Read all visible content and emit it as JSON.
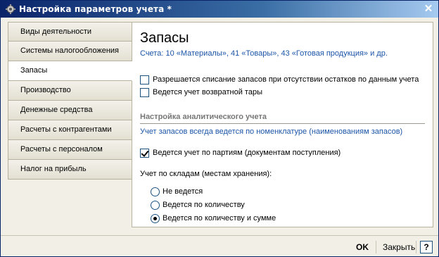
{
  "window": {
    "title": "Настройка параметров учета *",
    "close_glyph": "✕"
  },
  "sidebar": {
    "items": [
      {
        "label": "Виды деятельности",
        "active": false
      },
      {
        "label": "Системы налогообложения",
        "active": false
      },
      {
        "label": "Запасы",
        "active": true
      },
      {
        "label": "Производство",
        "active": false
      },
      {
        "label": "Денежные средства",
        "active": false
      },
      {
        "label": "Расчеты с контрагентами",
        "active": false
      },
      {
        "label": "Расчеты с персоналом",
        "active": false
      },
      {
        "label": "Налог на прибыль",
        "active": false
      }
    ]
  },
  "main": {
    "title": "Запасы",
    "accounts_link": "Счета: 10 «Материалы», 41 «Товары», 43 «Готовая продукция» и др.",
    "checkboxes": [
      {
        "label": "Разрешается списание запасов при отсутствии остатков по данным учета",
        "checked": false
      },
      {
        "label": "Ведется учет возвратной тары",
        "checked": false
      }
    ],
    "section_title": "Настройка аналитического учета",
    "info_text": "Учет запасов всегда ведется по номенклатуре (наименованиям запасов)",
    "batch_checkbox": {
      "label": "Ведется учет по партиям (документам поступления)",
      "checked": true
    },
    "warehouse_label": "Учет по складам (местам хранения):",
    "warehouse_options": [
      {
        "label": "Не ведется",
        "selected": false
      },
      {
        "label": "Ведется по количеству",
        "selected": false
      },
      {
        "label": "Ведется по количеству и сумме",
        "selected": true
      }
    ]
  },
  "footer": {
    "ok_label": "OK",
    "close_label": "Закрыть",
    "help_label": "?"
  },
  "colors": {
    "title_bar": "#0a246a",
    "link": "#1c55a8",
    "panel_bg": "#ffffff",
    "window_bg": "#f1efe6"
  }
}
